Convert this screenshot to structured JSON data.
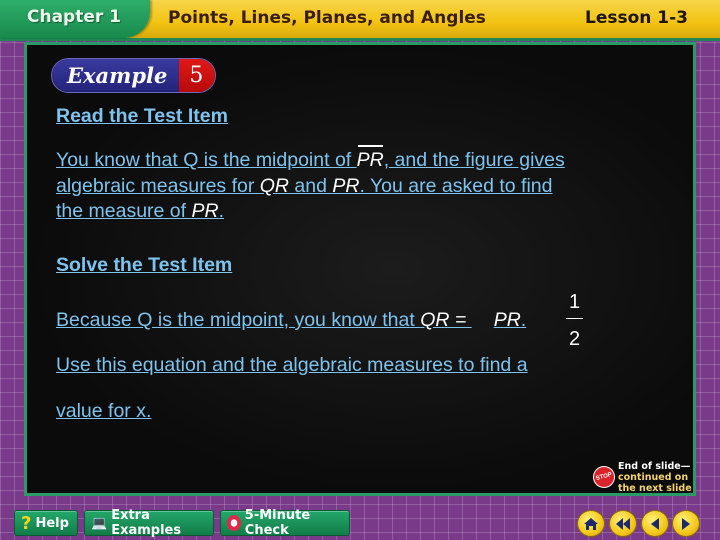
{
  "header": {
    "chapter": "Chapter 1",
    "title": "Points, Lines, Planes, and Angles",
    "lesson": "Lesson 1-3"
  },
  "example": {
    "word": "Example",
    "number": "5"
  },
  "content": {
    "read_heading": "Read the Test Item",
    "read_p1a": "You know that Q is the midpoint of ",
    "seg_pr": "PR",
    "read_p1b": ", and the figure gives",
    "read_p2a": "algebraic measures for ",
    "seg_qr": "QR",
    "read_p2b": " and ",
    "read_p2c": ". You are asked to find",
    "read_p3a": "the measure of ",
    "read_p3b": ".",
    "solve_heading": "Solve the Test Item",
    "solve_p1": "Because Q is the midpoint, you know that ",
    "eq_left": "QR = ",
    "eq_num": "1",
    "eq_den": "2",
    "eq_right": "PR",
    "eq_end": ".",
    "solve_p2": "Use this equation and the algebraic measures to find a",
    "solve_p3": "value for x."
  },
  "end_note": {
    "stop_text": "STOP",
    "line1": "End of slide—",
    "line2": "continued on",
    "line3": "the next slide"
  },
  "footer": {
    "help": "Help",
    "extra": "Extra Examples",
    "check": "5-Minute Check"
  }
}
